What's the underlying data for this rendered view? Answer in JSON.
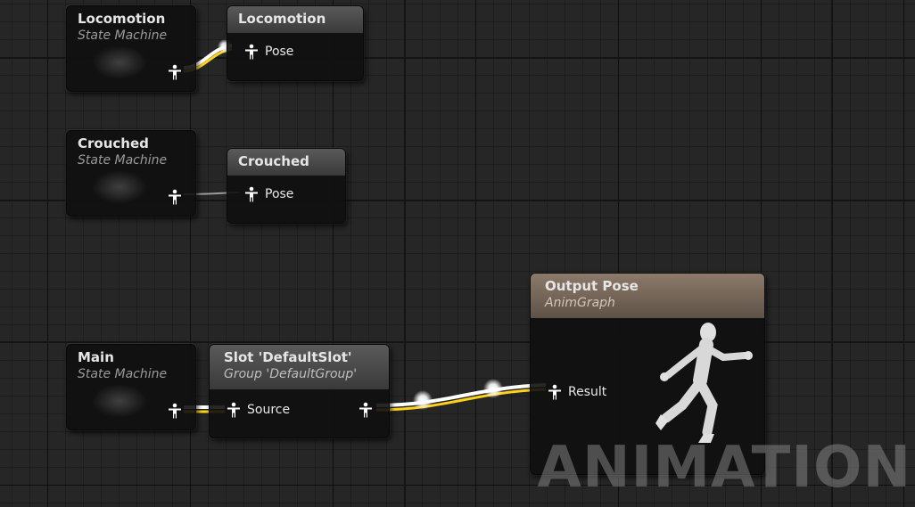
{
  "graph": {
    "nodes": {
      "locomotion_state_machine": {
        "title": "Locomotion",
        "subtitle": "State Machine"
      },
      "locomotion_pose": {
        "title": "Locomotion",
        "pin_label": "Pose"
      },
      "crouched_state_machine": {
        "title": "Crouched",
        "subtitle": "State Machine"
      },
      "crouched_pose": {
        "title": "Crouched",
        "pin_label": "Pose"
      },
      "main_state_machine": {
        "title": "Main",
        "subtitle": "State Machine"
      },
      "slot_node": {
        "title": "Slot 'DefaultSlot'",
        "subtitle": "Group 'DefaultGroup'",
        "input_pin_label": "Source"
      },
      "output_pose": {
        "title": "Output Pose",
        "subtitle": "AnimGraph",
        "pin_label": "Result"
      }
    },
    "watermark": "ANIMATION"
  },
  "colors": {
    "wire_white": "#ffffff",
    "wire_yellow": "#ffd21a",
    "output_header": "#8c7a6a",
    "node_header_gray": "#5a5a5a"
  },
  "icons": {
    "pose_pin": "person-pose-icon",
    "runner": "running-mannequin-icon"
  }
}
